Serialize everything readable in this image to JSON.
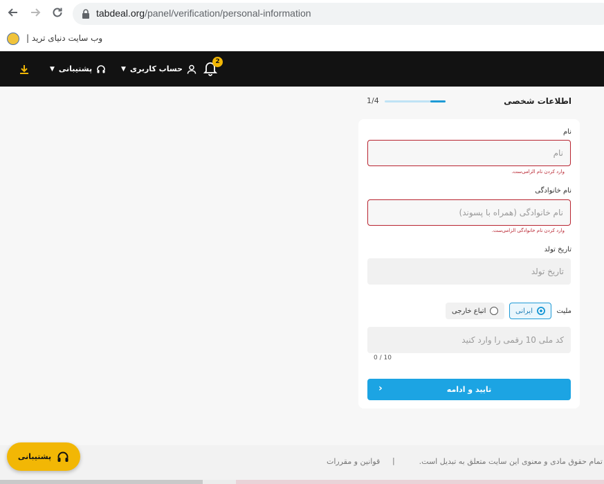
{
  "browser": {
    "url_host": "tabdeal.org",
    "url_path": "/panel/verification/personal-information",
    "bookmark_label": "وب سایت دنیای ترید |"
  },
  "header": {
    "notification_count": "2",
    "account_label": "حساب کاربری",
    "support_label": "پشتیبانی"
  },
  "form": {
    "title": "اطلاعات شخصی",
    "progress_text": "1/4",
    "progress_fraction": 0.25,
    "first_name": {
      "label": "نام",
      "placeholder": "نام",
      "value": "",
      "error": "وارد کردن نام الزامی‌ست."
    },
    "last_name": {
      "label": "نام خانوادگی",
      "placeholder": "نام خانوادگی (همراه با پسوند)",
      "value": "",
      "error": "وارد کردن نام خانوادگی الزامی‌ست."
    },
    "birth_date": {
      "label": "تاریخ تولد",
      "placeholder": "تاریخ تولد",
      "value": ""
    },
    "nationality": {
      "label": "ملیت",
      "options": [
        {
          "label": "ایرانی",
          "selected": true
        },
        {
          "label": "اتباع خارجی",
          "selected": false
        }
      ]
    },
    "national_code": {
      "placeholder": "کد ملی 10 رقمی را وارد کنید",
      "value": "",
      "counter": "0 / 10"
    },
    "submit_label": "تایید و ادامه"
  },
  "footer": {
    "copyright": "تمام حقوق مادی و معنوی این سایت متعلق به تبدیل است.",
    "separator": "|",
    "terms_link": "قوانین و مقررات"
  },
  "support_fab_label": "پشتیبانی",
  "colors": {
    "brand_yellow": "#f2b705",
    "primary_blue": "#1ca4e3",
    "error_red": "#b8232f",
    "header_bg": "#121212"
  }
}
